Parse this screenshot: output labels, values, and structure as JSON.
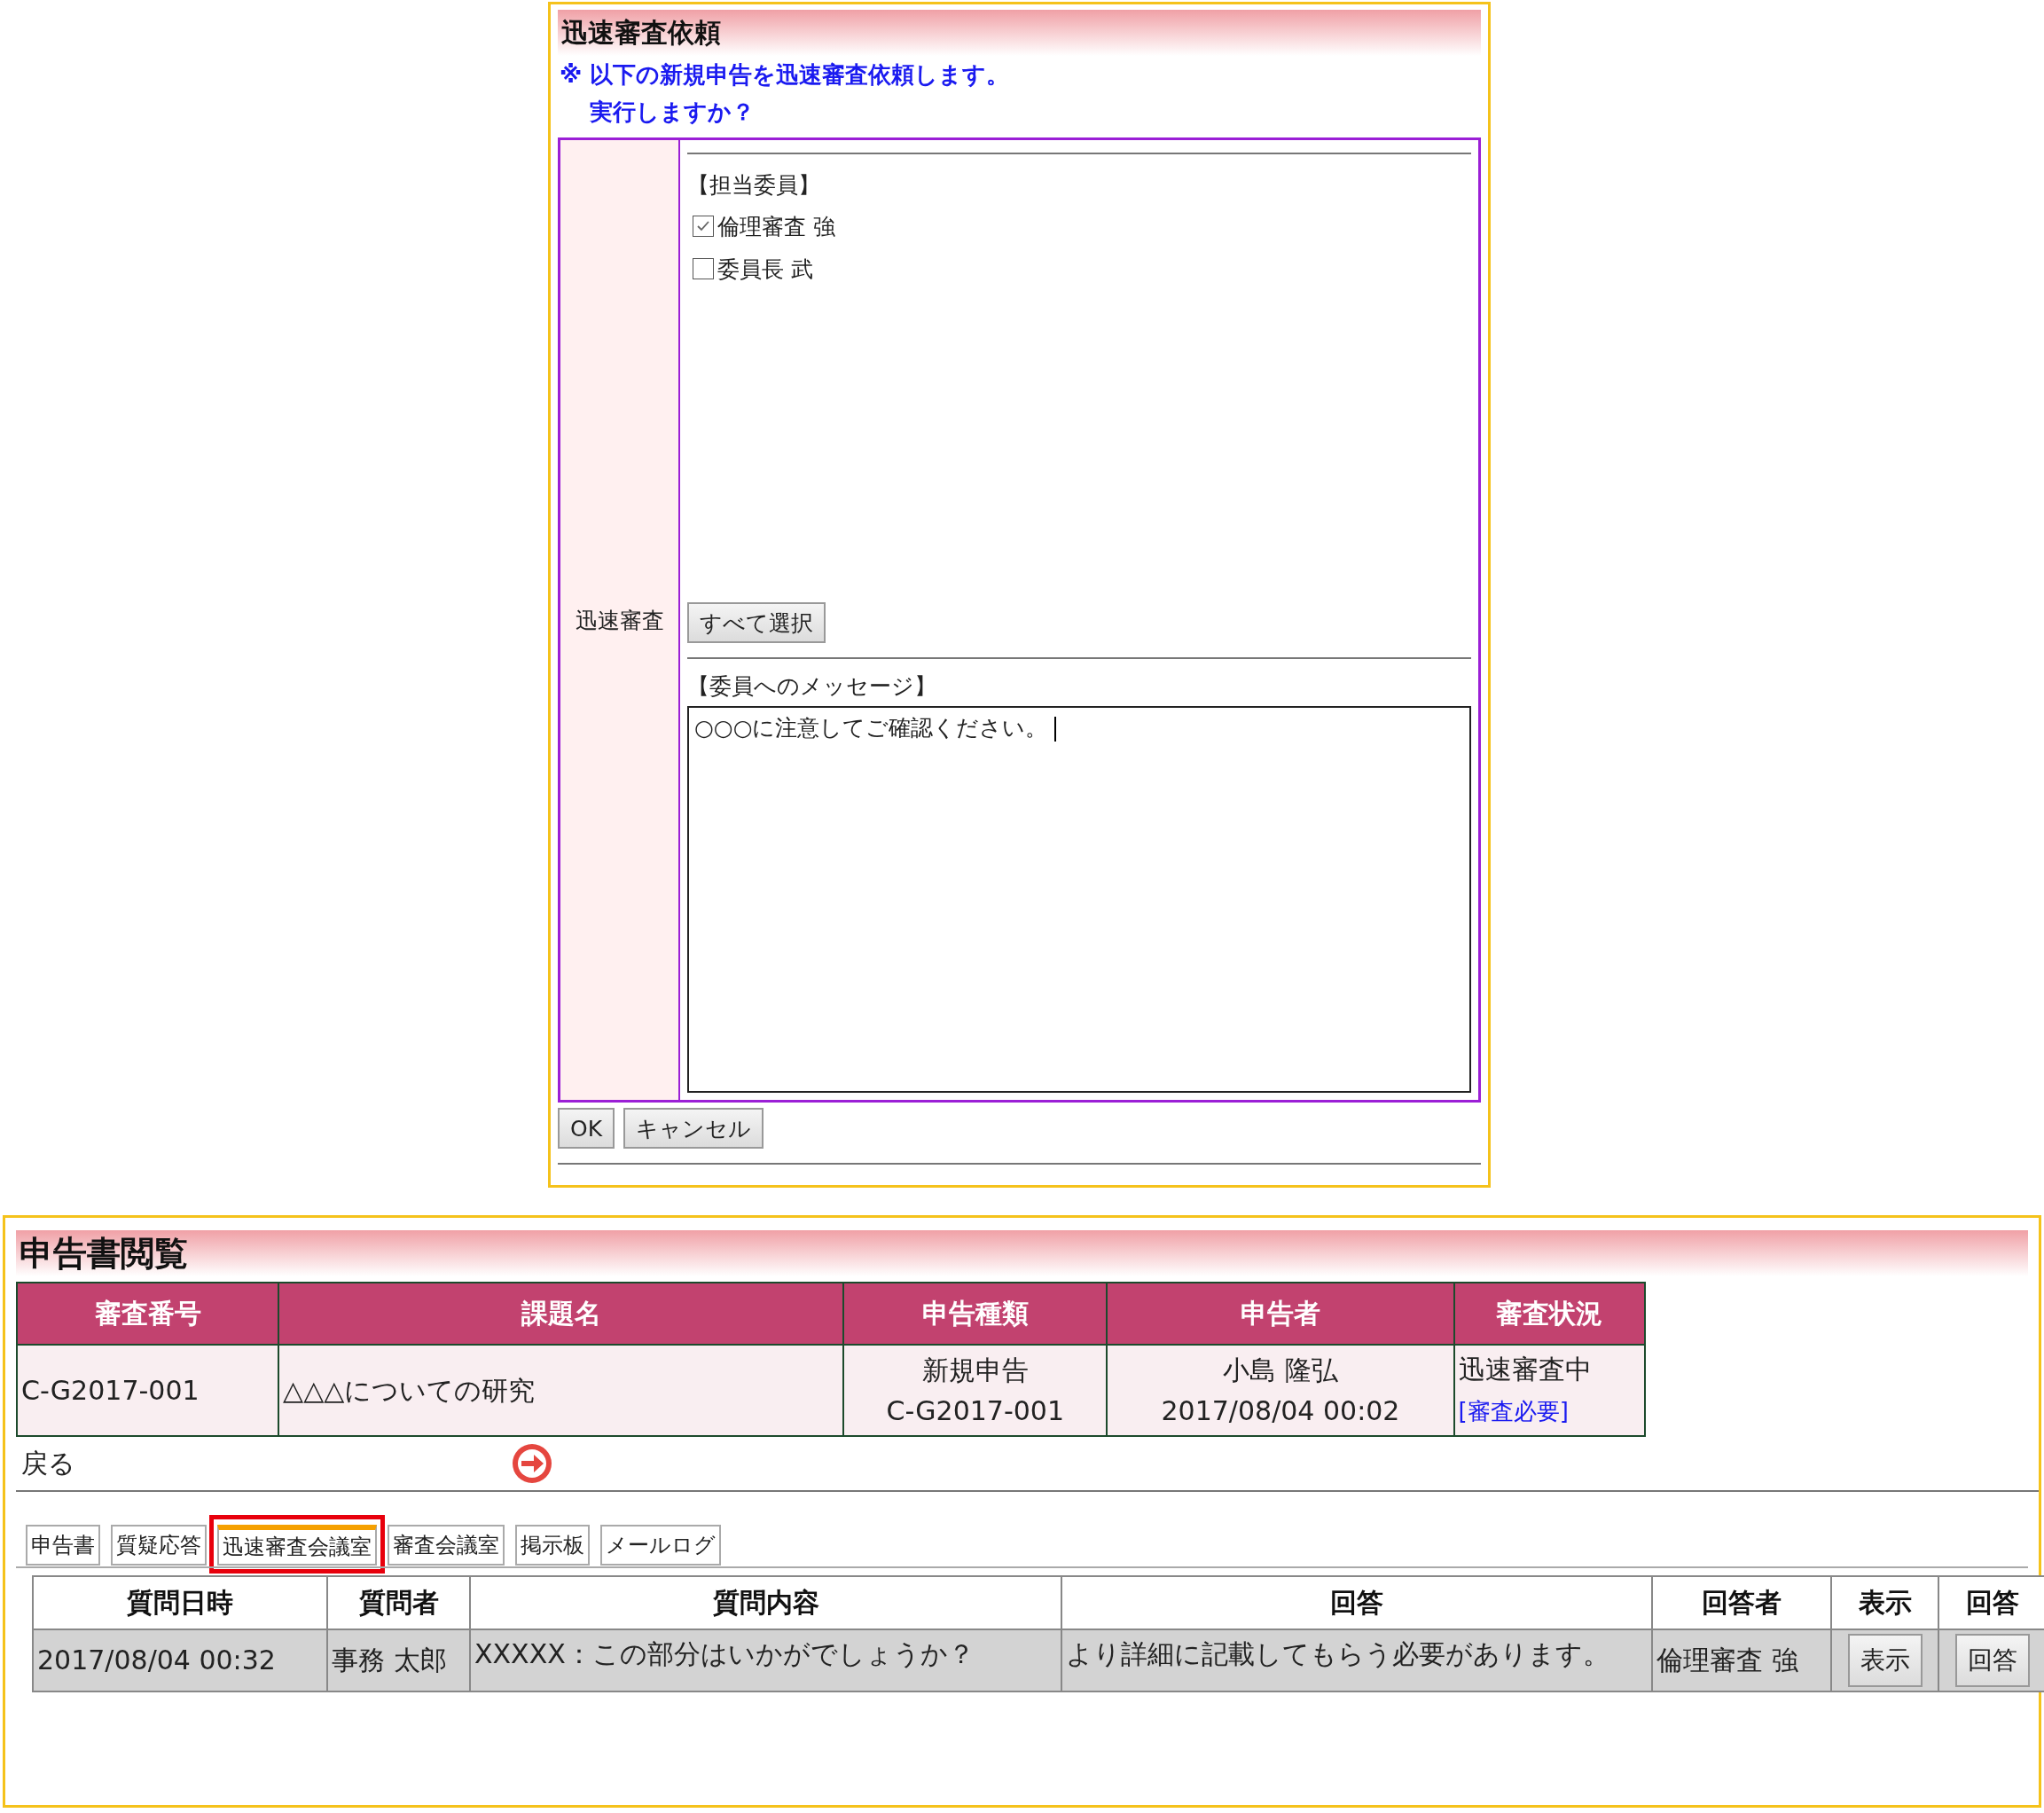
{
  "dialog": {
    "title": "迅速審査依頼",
    "notice": [
      "※ 以下の新規申告を迅速審査依頼します。",
      "実行しますか？"
    ],
    "form": {
      "label": "迅速審査",
      "members_heading": "【担当委員】",
      "members": [
        {
          "name": "倫理審査 強",
          "checked": true
        },
        {
          "name": "委員長 武",
          "checked": false
        }
      ],
      "select_all": "すべて選択",
      "message_heading": "【委員へのメッセージ】",
      "message": "○○○に注意してご確認ください。"
    },
    "buttons": [
      "OK",
      "キャンセル"
    ]
  },
  "viewer": {
    "title": "申告書閲覧",
    "summary": {
      "columns": [
        "審査番号",
        "課題名",
        "申告種類",
        "申告者",
        "審査状況"
      ],
      "row": {
        "number": "C-G2017-001",
        "subject": "△△△についての研究",
        "type": [
          "新規申告",
          "C-G2017-001"
        ],
        "applicant": [
          "小島 隆弘",
          "2017/08/04 00:02"
        ],
        "status": "迅速審査中",
        "status_link": "[審査必要]"
      }
    },
    "back": "戻る",
    "tabs": [
      {
        "label": "申告書",
        "selected": false,
        "highlighted": false
      },
      {
        "label": "質疑応答",
        "selected": false,
        "highlighted": false
      },
      {
        "label": "迅速審査会議室",
        "selected": true,
        "highlighted": true
      },
      {
        "label": "審査会議室",
        "selected": false,
        "highlighted": false
      },
      {
        "label": "掲示板",
        "selected": false,
        "highlighted": false
      },
      {
        "label": "メールログ",
        "selected": false,
        "highlighted": false
      }
    ],
    "questions": {
      "columns": [
        "質問日時",
        "質問者",
        "質問内容",
        "回答",
        "回答者",
        "表示",
        "回答"
      ],
      "rows": [
        {
          "date": "2017/08/04 00:32",
          "asker": "事務 太郎",
          "question": "XXXXX：この部分はいかがでしょうか？",
          "answer": "より詳細に記載してもらう必要があります。",
          "answerer": "倫理審査 強",
          "view_button": "表示",
          "answer_button": "回答"
        }
      ]
    }
  }
}
